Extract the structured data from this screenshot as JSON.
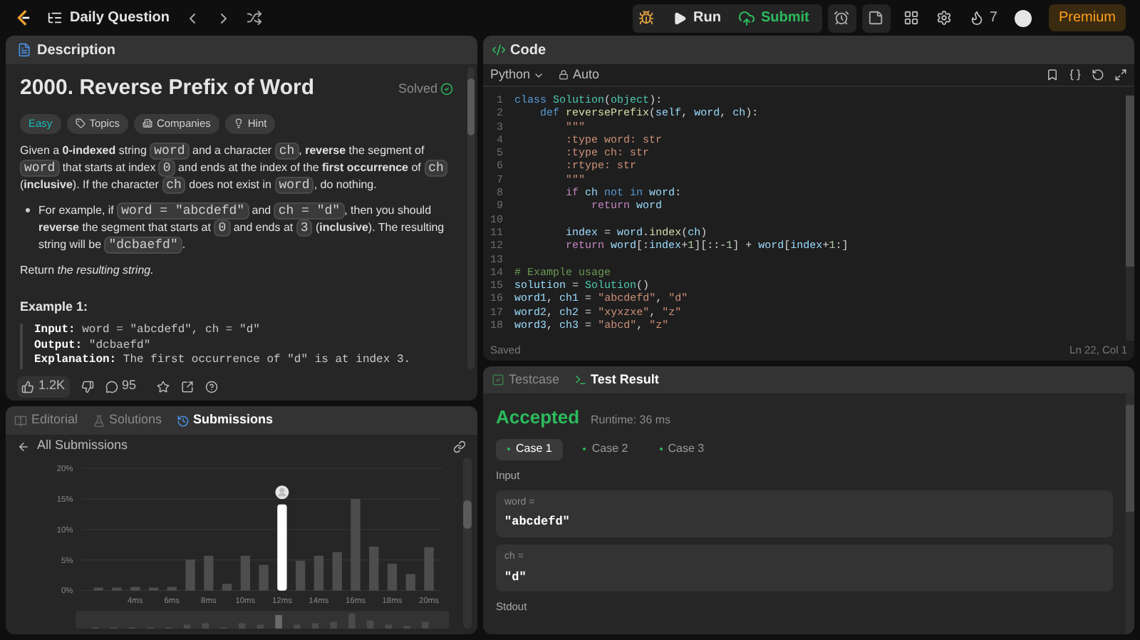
{
  "top_bar": {
    "title": "Daily Question",
    "run": "Run",
    "submit": "Submit",
    "streak": "7",
    "premium": "Premium"
  },
  "description": {
    "tab": "Description",
    "title": "2000. Reverse Prefix of Word",
    "solved": "Solved",
    "tags": [
      {
        "label": "Easy",
        "kind": "difficulty"
      },
      {
        "label": "Topics",
        "kind": "topics"
      },
      {
        "label": "Companies",
        "kind": "companies"
      },
      {
        "label": "Hint",
        "kind": "hint"
      }
    ],
    "paragraphs": [
      {
        "kind": "para",
        "parts": [
          {
            "kind": "text",
            "text": "Given a **0-indexed** string "
          },
          {
            "kind": "code",
            "text": "word"
          },
          {
            "kind": "text",
            "text": " and a character "
          },
          {
            "kind": "code",
            "text": "ch"
          },
          {
            "kind": "text",
            "text": ", **reverse** the segment of "
          },
          {
            "kind": "code",
            "text": "word"
          },
          {
            "kind": "text",
            "text": " that starts at index "
          },
          {
            "kind": "code",
            "text": "0"
          },
          {
            "kind": "text",
            "text": " and ends at the index of the **first occurrence** of "
          },
          {
            "kind": "code",
            "text": "ch"
          },
          {
            "kind": "text",
            "text": " (**inclusive**). If the character "
          },
          {
            "kind": "code",
            "text": "ch"
          },
          {
            "kind": "text",
            "text": " does not exist in "
          },
          {
            "kind": "code",
            "text": "word"
          },
          {
            "kind": "text",
            "text": ", do nothing."
          }
        ]
      },
      {
        "kind": "bullet",
        "parts": [
          {
            "kind": "text",
            "text": "For example, if "
          },
          {
            "kind": "code",
            "text": "word = \"abcdefd\""
          },
          {
            "kind": "text",
            "text": " and "
          },
          {
            "kind": "code",
            "text": "ch = \"d\""
          },
          {
            "kind": "text",
            "text": ", then you should **reverse** the segment that starts at "
          },
          {
            "kind": "code",
            "text": "0"
          },
          {
            "kind": "text",
            "text": " and ends at "
          },
          {
            "kind": "code",
            "text": "3"
          },
          {
            "kind": "text",
            "text": " (**inclusive**). The resulting string will be "
          },
          {
            "kind": "code",
            "text": "\"dcbaefd\""
          },
          {
            "kind": "text",
            "text": "."
          }
        ]
      },
      {
        "kind": "para",
        "parts": [
          {
            "kind": "text",
            "text": "Return *the resulting string.*"
          }
        ]
      }
    ],
    "example_title": "Example 1:",
    "example_lines": [
      {
        "label": "Input:",
        "text": " word = \"abcdefd\", ch = \"d\""
      },
      {
        "label": "Output:",
        "text": " \"dcbaefd\""
      },
      {
        "label": "Explanation:",
        "text": " The first occurrence of \"d\" is at index 3."
      }
    ],
    "likes": "1.2K",
    "comments": "95"
  },
  "submissions": {
    "tabs": [
      {
        "label": "Editorial",
        "selected": false
      },
      {
        "label": "Solutions",
        "selected": false
      },
      {
        "label": "Submissions",
        "selected": true
      }
    ],
    "back": "All Submissions",
    "chart_data": {
      "type": "bar",
      "x": [
        2,
        3,
        4,
        5,
        6,
        7,
        8,
        9,
        10,
        11,
        12,
        13,
        14,
        15,
        16,
        17,
        18,
        19,
        20
      ],
      "xlim": [
        1.5,
        20.5
      ],
      "ylim": [
        0,
        20
      ],
      "grid": true,
      "yticks": [
        {
          "value": 0,
          "label": "0%"
        },
        {
          "value": 5,
          "label": "5%"
        },
        {
          "value": 10,
          "label": "10%"
        },
        {
          "value": 15,
          "label": "15%"
        },
        {
          "value": 20,
          "label": "20%"
        }
      ],
      "xticks": [
        {
          "value": 4,
          "label": "4ms"
        },
        {
          "value": 6,
          "label": "6ms"
        },
        {
          "value": 8,
          "label": "8ms"
        },
        {
          "value": 10,
          "label": "10ms"
        },
        {
          "value": 12,
          "label": "12ms"
        },
        {
          "value": 14,
          "label": "14ms"
        },
        {
          "value": 16,
          "label": "16ms"
        },
        {
          "value": 18,
          "label": "18ms"
        },
        {
          "value": 20,
          "label": "20ms"
        }
      ],
      "stacked": true,
      "series": [
        {
          "color": "#4d4d4d",
          "values": [
            0.5,
            0.5,
            0.6,
            0.5,
            0.6,
            5.1,
            5.7,
            1.1,
            5.7,
            4.2,
            null,
            4.9,
            5.7,
            6.3,
            15,
            7.2,
            4.4,
            2.7,
            7.1
          ]
        },
        {
          "color": "#ffffff",
          "values": [
            null,
            null,
            null,
            null,
            null,
            null,
            null,
            null,
            null,
            null,
            14.1,
            null,
            null,
            null,
            null,
            null,
            null,
            null,
            null
          ]
        }
      ]
    }
  },
  "code": {
    "tab": "Code",
    "language": "Python",
    "mode": "Auto",
    "status": "Saved",
    "cursor": "Ln 22, Col 1",
    "lines": [
      {
        "number": "1",
        "tokens": [
          {
            "kind": "kw",
            "text": "class "
          },
          {
            "kind": "cls",
            "text": "Solution"
          },
          {
            "kind": "p",
            "text": "("
          },
          {
            "kind": "cls",
            "text": "object"
          },
          {
            "kind": "p",
            "text": "):"
          }
        ]
      },
      {
        "number": "2",
        "tokens": [
          {
            "kind": "kw",
            "text": "    def "
          },
          {
            "kind": "fn",
            "text": "reversePrefix"
          },
          {
            "kind": "p",
            "text": "("
          },
          {
            "kind": "var",
            "text": "self"
          },
          {
            "kind": "p",
            "text": ", "
          },
          {
            "kind": "var",
            "text": "word"
          },
          {
            "kind": "p",
            "text": ", "
          },
          {
            "kind": "var",
            "text": "ch"
          },
          {
            "kind": "p",
            "text": "):"
          }
        ]
      },
      {
        "number": "3",
        "tokens": [
          {
            "kind": "str",
            "text": "        \"\"\""
          }
        ]
      },
      {
        "number": "4",
        "tokens": [
          {
            "kind": "str",
            "text": "        :type word: str"
          }
        ]
      },
      {
        "number": "5",
        "tokens": [
          {
            "kind": "str",
            "text": "        :type ch: str"
          }
        ]
      },
      {
        "number": "6",
        "tokens": [
          {
            "kind": "str",
            "text": "        :rtype: str"
          }
        ]
      },
      {
        "number": "7",
        "tokens": [
          {
            "kind": "str",
            "text": "        \"\"\""
          }
        ]
      },
      {
        "number": "8",
        "tokens": [
          {
            "kind": "ctl",
            "text": "        if "
          },
          {
            "kind": "var",
            "text": "ch "
          },
          {
            "kind": "kw",
            "text": "not in "
          },
          {
            "kind": "var",
            "text": "word"
          },
          {
            "kind": "p",
            "text": ":"
          }
        ]
      },
      {
        "number": "9",
        "tokens": [
          {
            "kind": "ctl",
            "text": "            return "
          },
          {
            "kind": "var",
            "text": "word"
          }
        ]
      },
      {
        "number": "10"
      },
      {
        "number": "11",
        "tokens": [
          {
            "kind": "var",
            "text": "        index"
          },
          {
            "kind": "p",
            "text": " = "
          },
          {
            "kind": "var",
            "text": "word"
          },
          {
            "kind": "p",
            "text": "."
          },
          {
            "kind": "fn",
            "text": "index"
          },
          {
            "kind": "p",
            "text": "("
          },
          {
            "kind": "var",
            "text": "ch"
          },
          {
            "kind": "p",
            "text": ")"
          }
        ]
      },
      {
        "number": "12",
        "tokens": [
          {
            "kind": "ctl",
            "text": "        return "
          },
          {
            "kind": "var",
            "text": "word"
          },
          {
            "kind": "p",
            "text": "[:"
          },
          {
            "kind": "var",
            "text": "index"
          },
          {
            "kind": "p",
            "text": "+"
          },
          {
            "kind": "num",
            "text": "1"
          },
          {
            "kind": "p",
            "text": "][::-"
          },
          {
            "kind": "num",
            "text": "1"
          },
          {
            "kind": "p",
            "text": "] + "
          },
          {
            "kind": "var",
            "text": "word"
          },
          {
            "kind": "p",
            "text": "["
          },
          {
            "kind": "var",
            "text": "index"
          },
          {
            "kind": "p",
            "text": "+"
          },
          {
            "kind": "num",
            "text": "1"
          },
          {
            "kind": "p",
            "text": ":]"
          }
        ]
      },
      {
        "number": "13"
      },
      {
        "number": "14",
        "tokens": [
          {
            "kind": "cm",
            "text": "# Example usage"
          }
        ]
      },
      {
        "number": "15",
        "tokens": [
          {
            "kind": "var",
            "text": "solution"
          },
          {
            "kind": "p",
            "text": " = "
          },
          {
            "kind": "cls",
            "text": "Solution"
          },
          {
            "kind": "p",
            "text": "()"
          }
        ]
      },
      {
        "number": "16",
        "tokens": [
          {
            "kind": "var",
            "text": "word1"
          },
          {
            "kind": "p",
            "text": ", "
          },
          {
            "kind": "var",
            "text": "ch1"
          },
          {
            "kind": "p",
            "text": " = "
          },
          {
            "kind": "str",
            "text": "\"abcdefd\""
          },
          {
            "kind": "p",
            "text": ", "
          },
          {
            "kind": "str",
            "text": "\"d\""
          }
        ]
      },
      {
        "number": "17",
        "tokens": [
          {
            "kind": "var",
            "text": "word2"
          },
          {
            "kind": "p",
            "text": ", "
          },
          {
            "kind": "var",
            "text": "ch2"
          },
          {
            "kind": "p",
            "text": " = "
          },
          {
            "kind": "str",
            "text": "\"xyxzxe\""
          },
          {
            "kind": "p",
            "text": ", "
          },
          {
            "kind": "str",
            "text": "\"z\""
          }
        ]
      },
      {
        "number": "18",
        "tokens": [
          {
            "kind": "var",
            "text": "word3"
          },
          {
            "kind": "p",
            "text": ", "
          },
          {
            "kind": "var",
            "text": "ch3"
          },
          {
            "kind": "p",
            "text": " = "
          },
          {
            "kind": "str",
            "text": "\"abcd\""
          },
          {
            "kind": "p",
            "text": ", "
          },
          {
            "kind": "str",
            "text": "\"z\""
          }
        ]
      }
    ]
  },
  "test_result": {
    "tabs": [
      {
        "label": "Testcase",
        "selected": false
      },
      {
        "label": "Test Result",
        "selected": true
      }
    ],
    "verdict": "Accepted",
    "runtime": "Runtime: 36 ms",
    "cases": [
      {
        "label": "Case 1",
        "selected": true
      },
      {
        "label": "Case 2",
        "selected": false
      },
      {
        "label": "Case 3",
        "selected": false
      }
    ],
    "input_label": "Input",
    "inputs": [
      {
        "name": "word =",
        "value": "\"abcdefd\""
      },
      {
        "name": "ch =",
        "value": "\"d\""
      }
    ],
    "stdout_label": "Stdout"
  }
}
